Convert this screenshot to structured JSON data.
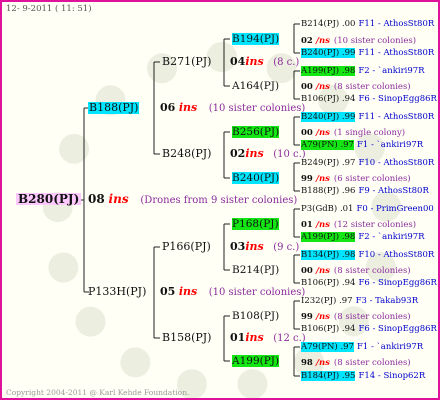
{
  "header": {
    "date": "12-  9-2011 ( 11: 51)"
  },
  "root": {
    "name": "B280(PJ)",
    "gen": "08",
    "ins": "ins",
    "desc": "(Drones from 9 sister colonies)"
  },
  "l1": {
    "name": "B188(PJ)",
    "gen": "06",
    "ins": "ins",
    "desc": "(10 sister colonies)"
  },
  "l2": {
    "name": "P133H(PJ)",
    "gen": "05",
    "ins": "ins",
    "desc": "(10 sister colonies)"
  },
  "l11": {
    "name": "B271(PJ)",
    "gen": "04",
    "ins": "ins",
    "desc": "(8 c.)"
  },
  "l12": {
    "name": "B248(PJ)",
    "gen": "02",
    "ins": "ins",
    "desc": "(10 c.)"
  },
  "l21": {
    "name": "P166(PJ)",
    "gen": "03",
    "ins": "ins",
    "desc": "(9 c.)"
  },
  "l22": {
    "name": "B158(PJ)",
    "gen": "01",
    "ins": "ins",
    "desc": "(12 c.)"
  },
  "l111": {
    "name": "B194(PJ)"
  },
  "l112": {
    "name": "A164(PJ)"
  },
  "l121": {
    "name": "B256(PJ)"
  },
  "l122": {
    "name": "B240(PJ)"
  },
  "l211": {
    "name": "P168(PJ)"
  },
  "l212": {
    "name": "B214(PJ)"
  },
  "l221": {
    "name": "B108(PJ)"
  },
  "l222": {
    "name": "A199(PJ)"
  },
  "right": [
    {
      "a": "B214(PJ) .00",
      "b": "F11 - AthosSt80R"
    },
    {
      "a": "02",
      "ins": "/ns",
      "c": "(10 sister colonies)"
    },
    {
      "a": "B240(PJ) .99",
      "b": "F11 - AthosSt80R"
    },
    {
      "a": "A199(PJ) .98",
      "b": "F2 - `ankiri97R"
    },
    {
      "a": "00",
      "ins": "/ns",
      "c": "(8 sister colonies)"
    },
    {
      "a": "B106(PJ) .94",
      "b": "F6 - SinopEgg86R"
    },
    {
      "a": "B240(PJ) .99",
      "b": "F11 - AthosSt80R"
    },
    {
      "a": "00",
      "ins": "/ns",
      "c": "(1 single colony)"
    },
    {
      "a": "A79(PN) .97",
      "b": "F1 - `ankiri97R"
    },
    {
      "a": "B249(PJ) .97",
      "b": "F10 - AthosSt80R"
    },
    {
      "a": "99",
      "ins": "/ns",
      "c": "(6 sister colonies)"
    },
    {
      "a": "B188(PJ) .96",
      "b": "F9 - AthosSt80R"
    },
    {
      "a": "P3(GdB) .01",
      "b": "F0 - PrimGreen00"
    },
    {
      "a": "01",
      "ins": "/ns",
      "c": "(12 sister colonies)"
    },
    {
      "a": "A199(PJ) .98",
      "b": "F2 - `ankiri97R"
    },
    {
      "a": "B134(PJ) .98",
      "b": "F10 - AthosSt80R"
    },
    {
      "a": "00",
      "ins": "/ns",
      "c": "(8 sister colonies)"
    },
    {
      "a": "B106(PJ) .94",
      "b": "F6 - SinopEgg86R"
    },
    {
      "a": "I232(PJ) .97",
      "b": "F3 - Takab93R"
    },
    {
      "a": "99",
      "ins": "/ns",
      "c": "(8 sister colonies)"
    },
    {
      "a": "B106(PJ) .94",
      "b": "F6 - SinopEgg86R"
    },
    {
      "a": "A79(PN) .97",
      "b": "F1 - `ankiri97R"
    },
    {
      "a": "98",
      "ins": "/ns",
      "c": "(8 sister colonies)"
    },
    {
      "a": "B184(PJ) .95",
      "b": "F14 - Sinop62R"
    }
  ],
  "footer": {
    "copyright": "Copyright 2004-2011 @ Karl Kehde Foundation."
  }
}
